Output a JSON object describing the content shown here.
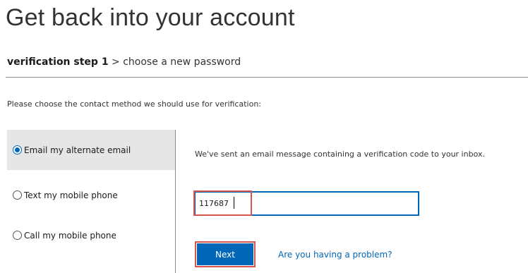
{
  "page": {
    "title": "Get back into your account",
    "breadcrumb": {
      "current_step": "verification step 1",
      "separator": ">",
      "next_step": "choose a new password"
    },
    "instruction": "Please choose the contact method we should use for verification:"
  },
  "methods": {
    "items": [
      {
        "label": "Email my alternate email",
        "selected": true
      },
      {
        "label": "Text my mobile phone",
        "selected": false
      },
      {
        "label": "Call my mobile phone",
        "selected": false
      }
    ]
  },
  "verification": {
    "message": "We've sent an email message containing a verification code to your inbox.",
    "code_value": "117687"
  },
  "actions": {
    "next_label": "Next",
    "problem_link": "Are you having a problem?"
  },
  "colors": {
    "accent": "#0067b8",
    "highlight": "#d9534f",
    "selected_bg": "#e6e6e6"
  }
}
